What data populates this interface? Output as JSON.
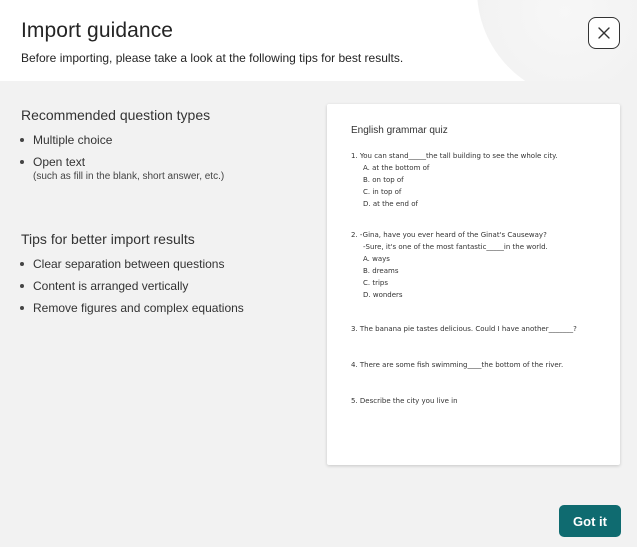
{
  "header": {
    "title": "Import guidance",
    "subtitle": "Before importing, please take a look at the following tips for best results."
  },
  "close_button": {
    "icon": "close-icon"
  },
  "recommended": {
    "title": "Recommended question types",
    "items": [
      {
        "label": "Multiple choice"
      },
      {
        "label": "Open text",
        "note": "(such as fill in the blank, short answer, etc.)"
      }
    ]
  },
  "tips": {
    "title": "Tips for better import results",
    "items": [
      {
        "label": "Clear separation between questions"
      },
      {
        "label": "Content is arranged vertically"
      },
      {
        "label": "Remove figures and complex equations"
      }
    ]
  },
  "preview": {
    "title": "English grammar quiz",
    "questions": [
      {
        "lines": [
          "1.  You can stand_____the tall building to see the whole city."
        ],
        "options": [
          "A. at the bottom of",
          "B. on top of",
          "C. in top of",
          "D. at the end of"
        ]
      },
      {
        "lines": [
          "2.  -Gina, have you ever heard of the Ginat's Causeway?",
          "-Sure, it's one of the most fantastic_____in the world."
        ],
        "options": [
          "A. ways",
          "B. dreams",
          "C. trips",
          "D. wonders"
        ]
      },
      {
        "lines": [
          "3.  The banana pie tastes delicious. Could I have another_______?"
        ],
        "options": []
      },
      {
        "lines": [
          "4.  There are some fish swimming____the bottom of the river."
        ],
        "options": []
      },
      {
        "lines": [
          "5.  Describe the city you live in"
        ],
        "options": []
      }
    ]
  },
  "footer": {
    "primary_label": "Got it"
  },
  "colors": {
    "primary": "#0f6b70",
    "header_bg": "#ffffff",
    "body_bg": "#f2f2f2"
  }
}
